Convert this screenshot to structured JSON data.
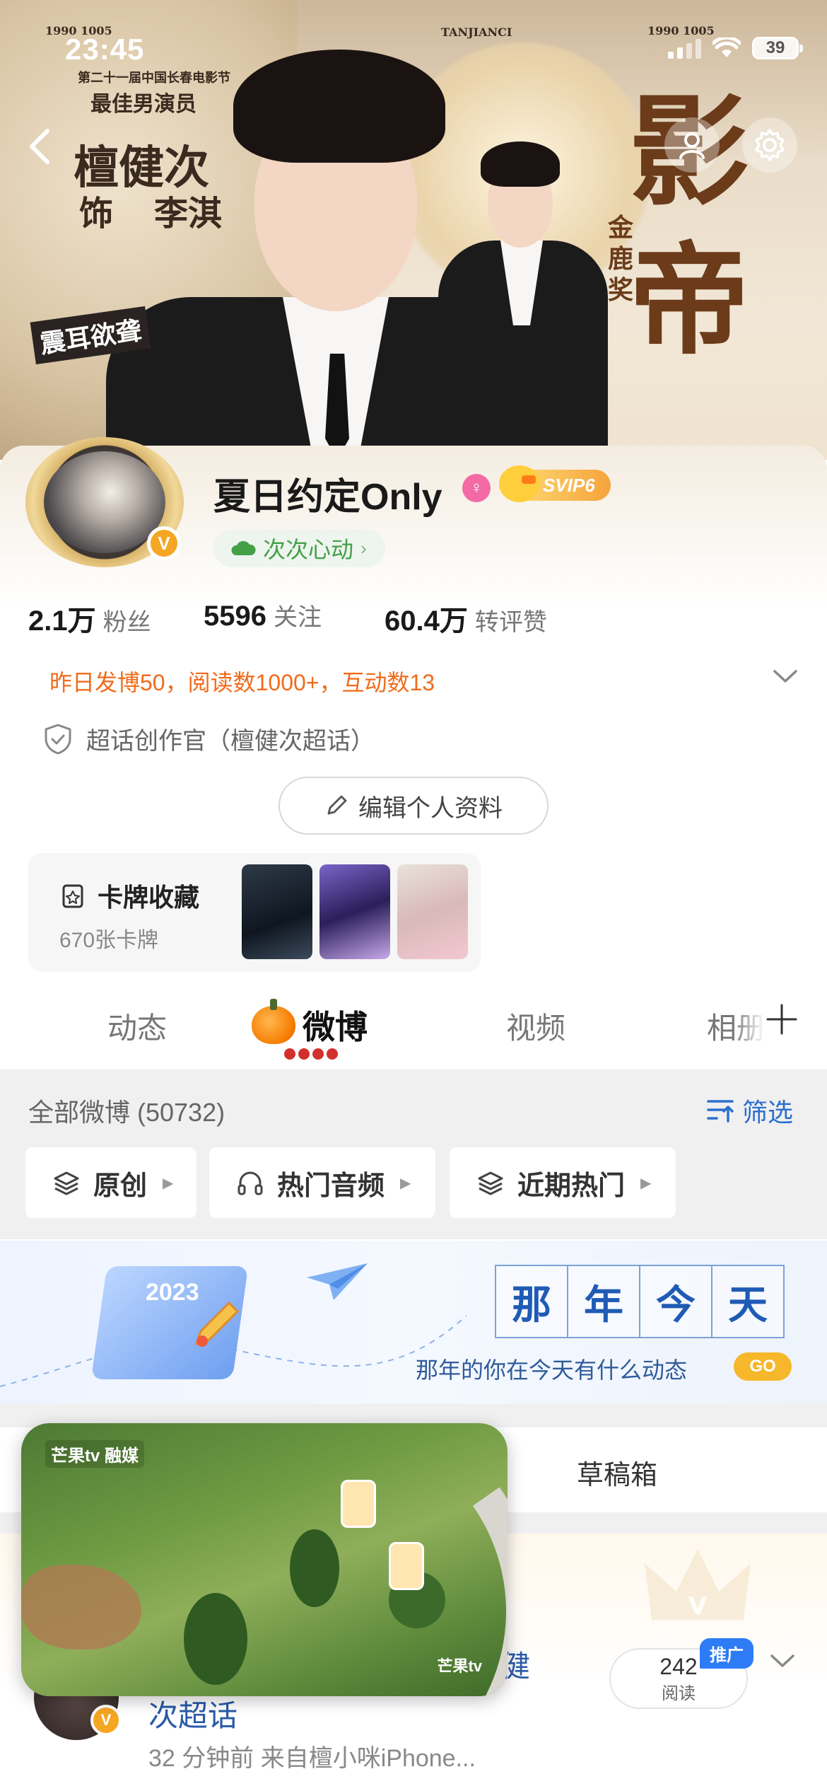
{
  "status_bar": {
    "time": "23:45",
    "battery": "39"
  },
  "banner": {
    "poster_lines": [
      "第二十一届中国长春电影节",
      "最佳男演员",
      "檀健次",
      "饰",
      "李淇",
      "震耳欲聋",
      "影帝",
      "金鹿奖",
      "TANJIANCI",
      "1990 1005"
    ]
  },
  "profile": {
    "username": "夏日约定Only",
    "svip_label": "SVIP6",
    "fan_badge_label": "次次心动",
    "stats": [
      {
        "num": "2.1万",
        "label": "粉丝"
      },
      {
        "num": "5596",
        "label": "关注"
      },
      {
        "num": "60.4万",
        "label": "转评赞"
      }
    ],
    "daily_summary": "昨日发博50，阅读数1000+，互动数13",
    "super_topic": "超话创作官（檀健次超话）",
    "edit_profile_label": "编辑个人资料",
    "card_collection": {
      "title": "卡牌收藏",
      "count": "670张卡牌"
    }
  },
  "tabs": [
    {
      "label": "动态"
    },
    {
      "label": "微博"
    },
    {
      "label": "视频"
    },
    {
      "label": "相册"
    }
  ],
  "feed": {
    "all_weibo": "全部微博 (50732)",
    "filter_label": "筛选",
    "chips": [
      "原创",
      "热门音频",
      "近期热门"
    ],
    "nanian": {
      "chars": [
        "那",
        "年",
        "今",
        "天"
      ],
      "subtitle": "那年的你在今天有什么动态",
      "go": "GO",
      "calendar_year": "2023"
    },
    "drafts_label": "草稿箱",
    "post": {
      "title_part1": "健",
      "title_part2": "次超话",
      "meta": "32 分钟前  来自檀小咪iPhone...",
      "read_count": "242",
      "read_label": "阅读",
      "promo_tag": "推广"
    }
  },
  "video": {
    "logo_top_left": "芒果tv 融媒",
    "logo_bottom_right": "芒果tv"
  },
  "colors": {
    "accent_orange": "#f16b1b",
    "link_blue": "#2a6fd0",
    "svip_gold": "#f6a33b",
    "fan_green": "#43a047"
  }
}
